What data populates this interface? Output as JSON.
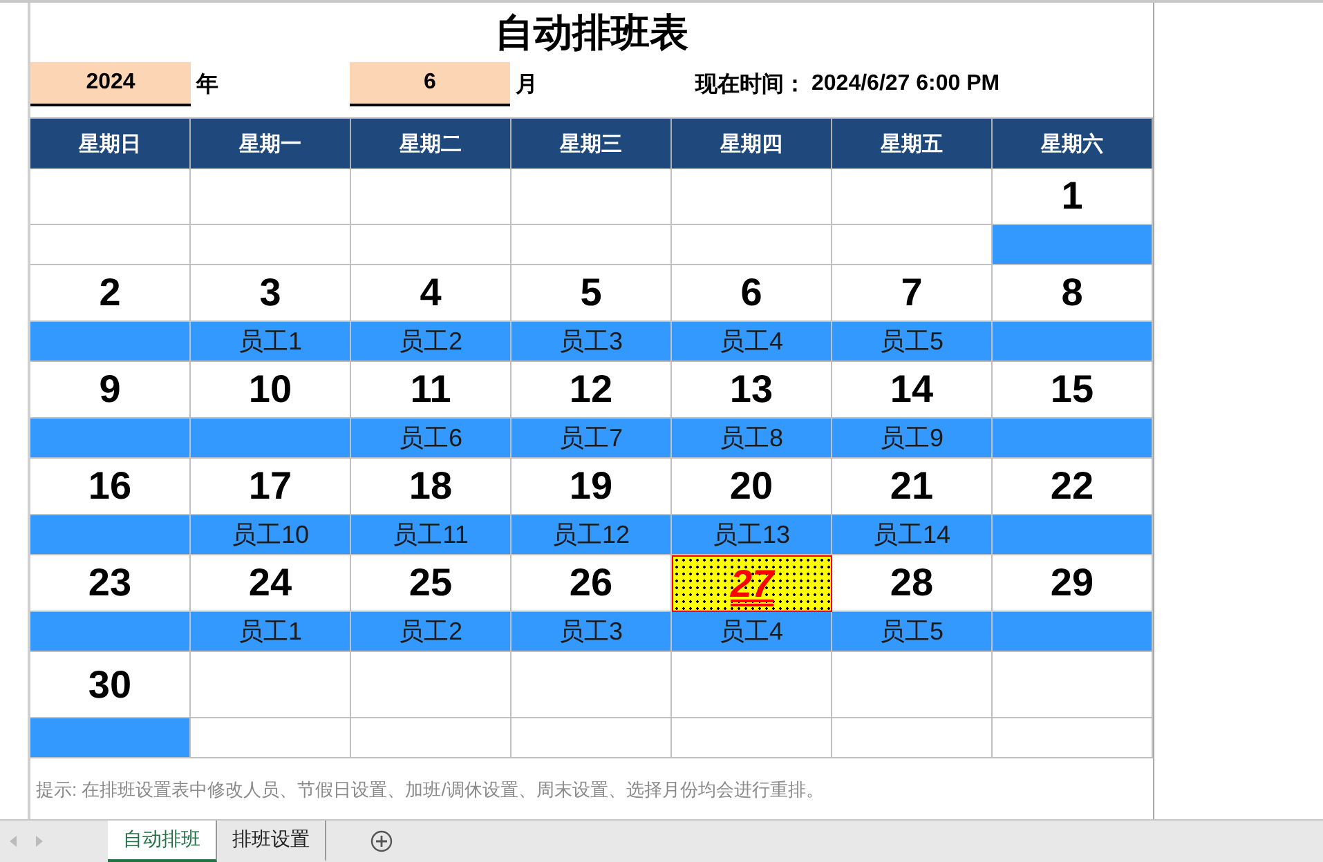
{
  "title": "自动排班表",
  "year": {
    "value": "2024",
    "label": "年"
  },
  "month": {
    "value": "6",
    "label": "月"
  },
  "now": {
    "label": "现在时间：",
    "value": "2024/6/27 6:00 PM"
  },
  "weekdays": [
    "星期日",
    "星期一",
    "星期二",
    "星期三",
    "星期四",
    "星期五",
    "星期六"
  ],
  "weeks": [
    {
      "days": [
        {
          "kind": "blank"
        },
        {
          "kind": "blank"
        },
        {
          "kind": "blank"
        },
        {
          "kind": "blank"
        },
        {
          "kind": "blank"
        },
        {
          "kind": "blank"
        },
        {
          "kind": "day",
          "day": "1",
          "today": false
        }
      ]
    },
    {
      "days": [
        {
          "day": "2",
          "today": false
        },
        {
          "day": "3",
          "staff": "员工1",
          "today": false
        },
        {
          "day": "4",
          "staff": "员工2",
          "today": false
        },
        {
          "day": "5",
          "staff": "员工3",
          "today": false
        },
        {
          "day": "6",
          "staff": "员工4",
          "today": false
        },
        {
          "day": "7",
          "staff": "员工5",
          "today": false
        },
        {
          "day": "8",
          "today": false
        }
      ]
    },
    {
      "days": [
        {
          "day": "9",
          "today": false
        },
        {
          "day": "10",
          "today": false
        },
        {
          "day": "11",
          "staff": "员工6",
          "today": false
        },
        {
          "day": "12",
          "staff": "员工7",
          "today": false
        },
        {
          "day": "13",
          "staff": "员工8",
          "today": false
        },
        {
          "day": "14",
          "staff": "员工9",
          "today": false
        },
        {
          "day": "15",
          "today": false
        }
      ]
    },
    {
      "days": [
        {
          "day": "16",
          "today": false
        },
        {
          "day": "17",
          "staff": "员工10",
          "today": false
        },
        {
          "day": "18",
          "staff": "员工11",
          "today": false
        },
        {
          "day": "19",
          "staff": "员工12",
          "today": false
        },
        {
          "day": "20",
          "staff": "员工13",
          "today": false
        },
        {
          "day": "21",
          "staff": "员工14",
          "today": false
        },
        {
          "day": "22",
          "today": false
        }
      ]
    },
    {
      "days": [
        {
          "day": "23",
          "today": false
        },
        {
          "day": "24",
          "staff": "员工1",
          "today": false
        },
        {
          "day": "25",
          "staff": "员工2",
          "today": false
        },
        {
          "day": "26",
          "staff": "员工3",
          "today": false
        },
        {
          "day": "27",
          "staff": "员工4",
          "today": true
        },
        {
          "day": "28",
          "staff": "员工5",
          "today": false
        },
        {
          "day": "29",
          "today": false
        }
      ]
    },
    {
      "days": [
        {
          "kind": "day",
          "day": "30",
          "today": false
        },
        {
          "kind": "blank"
        },
        {
          "kind": "blank"
        },
        {
          "kind": "blank"
        },
        {
          "kind": "blank"
        },
        {
          "kind": "blank"
        },
        {
          "kind": "blank"
        }
      ]
    }
  ],
  "hint": "提示: 在排班设置表中修改人员、节假日设置、加班/调休设置、周末设置、选择月份均会进行重排。",
  "sheet_tabs": [
    {
      "label": "自动排班",
      "selected": true
    },
    {
      "label": "排班设置",
      "selected": false
    }
  ]
}
